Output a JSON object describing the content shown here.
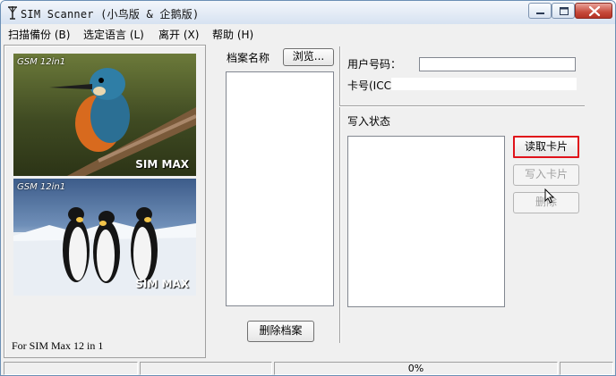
{
  "window": {
    "title": "SIM Scanner (小鸟版 & 企鹅版)",
    "app_icon": "antenna-icon",
    "controls": {
      "minimize": "minimize-icon",
      "maximize": "maximize-icon",
      "close": "close-icon"
    }
  },
  "menu": [
    {
      "label": "扫描備份 (B)"
    },
    {
      "label": "选定语言 (L)"
    },
    {
      "label": "离开 (X)"
    },
    {
      "label": "帮助 (H)"
    }
  ],
  "left_panel": {
    "image_top": {
      "label": "GSM 12in1",
      "logo": "SIM MAX"
    },
    "image_bottom": {
      "label": "GSM 12in1",
      "logo": "SIM MAX"
    },
    "caption": "For SIM Max 12 in 1"
  },
  "middle_panel": {
    "file_name_label": "档案名称",
    "browse_button": "浏览...",
    "delete_file_button": "删除档案"
  },
  "right_panel": {
    "user_number_label": "用户号码：",
    "user_number_value": "",
    "card_number_label": "卡号(ICC",
    "card_number_value": "",
    "write_status_label": "写入状态",
    "read_card_button": "读取卡片",
    "write_card_button": "写入卡片",
    "delete_button": "删除"
  },
  "status_bar": {
    "progress_text": "0%",
    "progress": 0
  },
  "colors": {
    "focus_border": "#e0121a",
    "window_border": "#6b8fb5"
  }
}
